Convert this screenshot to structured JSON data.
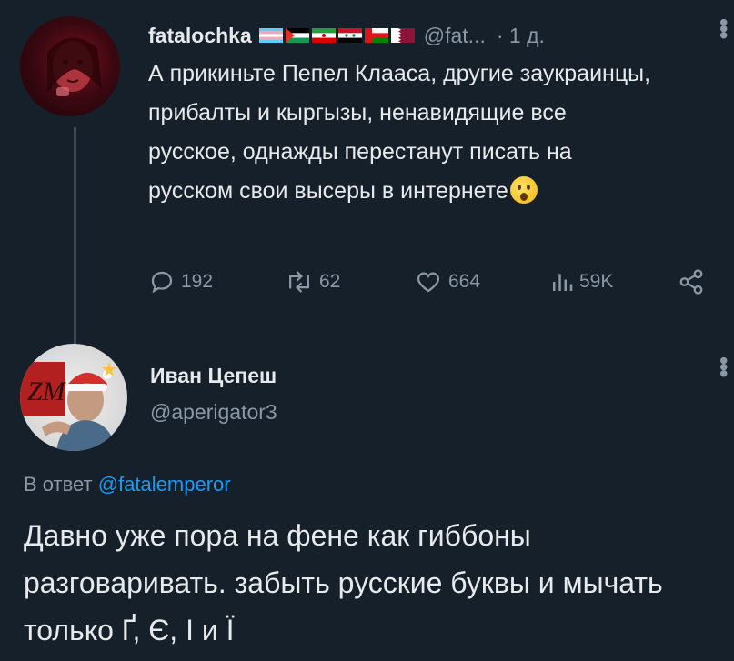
{
  "tweet1": {
    "name": "fatalochka",
    "flags": [
      "transgender-flag",
      "palestine-flag",
      "iran-flag",
      "syria-flag",
      "oman-flag",
      "qatar-flag"
    ],
    "handle": "@fat...",
    "time": "· 1 д.",
    "text": "А прикиньте Пепел Клааса, другие заукраинцы, прибалты и кыргызы, ненавидящие все русское, однажды перестанут писать на русском свои высеры в интернете",
    "emoji": "hushed-face-emoji",
    "replies": "192",
    "retweets": "62",
    "likes": "664",
    "views": "59K"
  },
  "tweet2": {
    "name": "Иван Цепеш",
    "handle": "@aperigator3",
    "reply_prefix": "В ответ ",
    "reply_handle": "@fatalemperor",
    "text": "Давно уже пора на фене как гиббоны разговаривать. забыть русские буквы и мычать только Ґ, Є, І и Ї"
  },
  "colors": {
    "background": "#15202b",
    "text": "#e7e9ea",
    "muted": "#8b98a5",
    "link": "#1d9bf0"
  }
}
